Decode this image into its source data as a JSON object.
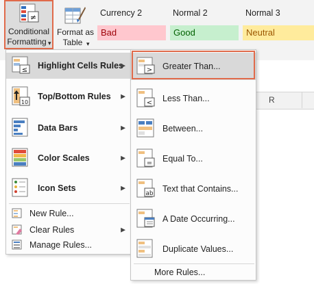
{
  "ribbon": {
    "conditional_formatting": {
      "line1": "Conditional",
      "line2": "Formatting",
      "caret": "▾"
    },
    "format_as_table": {
      "line1": "Format as",
      "line2": "Table",
      "caret": "▾"
    },
    "styles": [
      {
        "header": "Currency 2",
        "cell": "Bad"
      },
      {
        "header": "Normal 2",
        "cell": "Good"
      },
      {
        "header": "Normal 3",
        "cell": "Neutral"
      }
    ]
  },
  "sheet": {
    "column_header": "R"
  },
  "main_menu": {
    "items": [
      {
        "label": "Highlight Cells Rules",
        "icon": "highlight-cells-icon",
        "highlighted": true
      },
      {
        "label": "Top/Bottom Rules",
        "icon": "top-bottom-icon"
      },
      {
        "label": "Data Bars",
        "icon": "data-bars-icon"
      },
      {
        "label": "Color Scales",
        "icon": "color-scales-icon"
      },
      {
        "label": "Icon Sets",
        "icon": "icon-sets-icon"
      }
    ],
    "small_items": [
      {
        "label": "New Rule...",
        "icon": "new-rule-icon"
      },
      {
        "label": "Clear Rules",
        "icon": "clear-rules-icon"
      },
      {
        "label": "Manage Rules...",
        "icon": "manage-rules-icon"
      }
    ],
    "submenu_arrow": "▶"
  },
  "sub_menu": {
    "items": [
      {
        "label": "Greater Than...",
        "icon": "greater-than-icon",
        "highlighted": true
      },
      {
        "label": "Less Than...",
        "icon": "less-than-icon"
      },
      {
        "label": "Between...",
        "icon": "between-icon"
      },
      {
        "label": "Equal To...",
        "icon": "equal-to-icon"
      },
      {
        "label": "Text that Contains...",
        "icon": "text-contains-icon"
      },
      {
        "label": "A Date Occurring...",
        "icon": "date-occurring-icon"
      },
      {
        "label": "Duplicate Values...",
        "icon": "duplicate-values-icon"
      }
    ],
    "more": "More Rules..."
  },
  "colors": {
    "accent": "#e06a4a",
    "highlight": "#d9d9d9"
  }
}
